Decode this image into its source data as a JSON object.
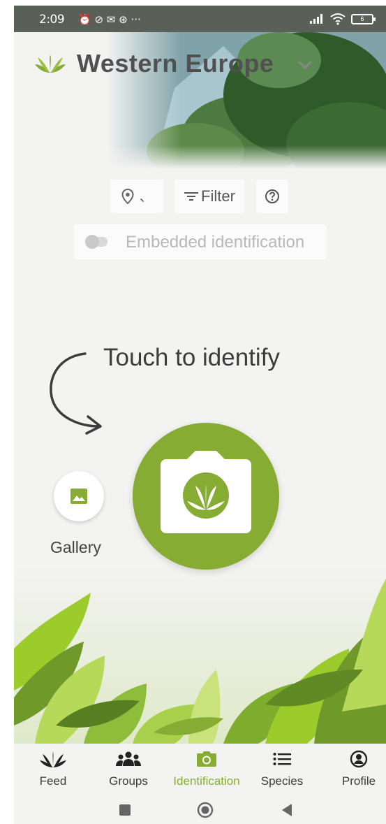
{
  "status_bar": {
    "time": "2:09",
    "left_icons": "⏰ ⊘ ✉ ⊛ ···",
    "battery": "6"
  },
  "header": {
    "region": "Western Europe",
    "logo_icon": "leaf-logo-icon",
    "chevron_icon": "chevron-down-icon"
  },
  "controls": {
    "location_value": "、",
    "filter_label": "Filter",
    "help_icon": "help-circle-icon",
    "embedded_label": "Embedded identification",
    "embedded_enabled": false
  },
  "main": {
    "touch_hint": "Touch to identify",
    "gallery_label": "Gallery"
  },
  "bottom_nav": {
    "items": [
      {
        "label": "Feed",
        "icon": "leaf-icon"
      },
      {
        "label": "Groups",
        "icon": "people-icon"
      },
      {
        "label": "Identification",
        "icon": "camera-icon",
        "active": true
      },
      {
        "label": "Species",
        "icon": "list-icon"
      },
      {
        "label": "Profile",
        "icon": "profile-icon"
      }
    ]
  },
  "colors": {
    "accent": "#86ac33",
    "text": "#3c3c3c",
    "background": "#f3f3f2"
  }
}
